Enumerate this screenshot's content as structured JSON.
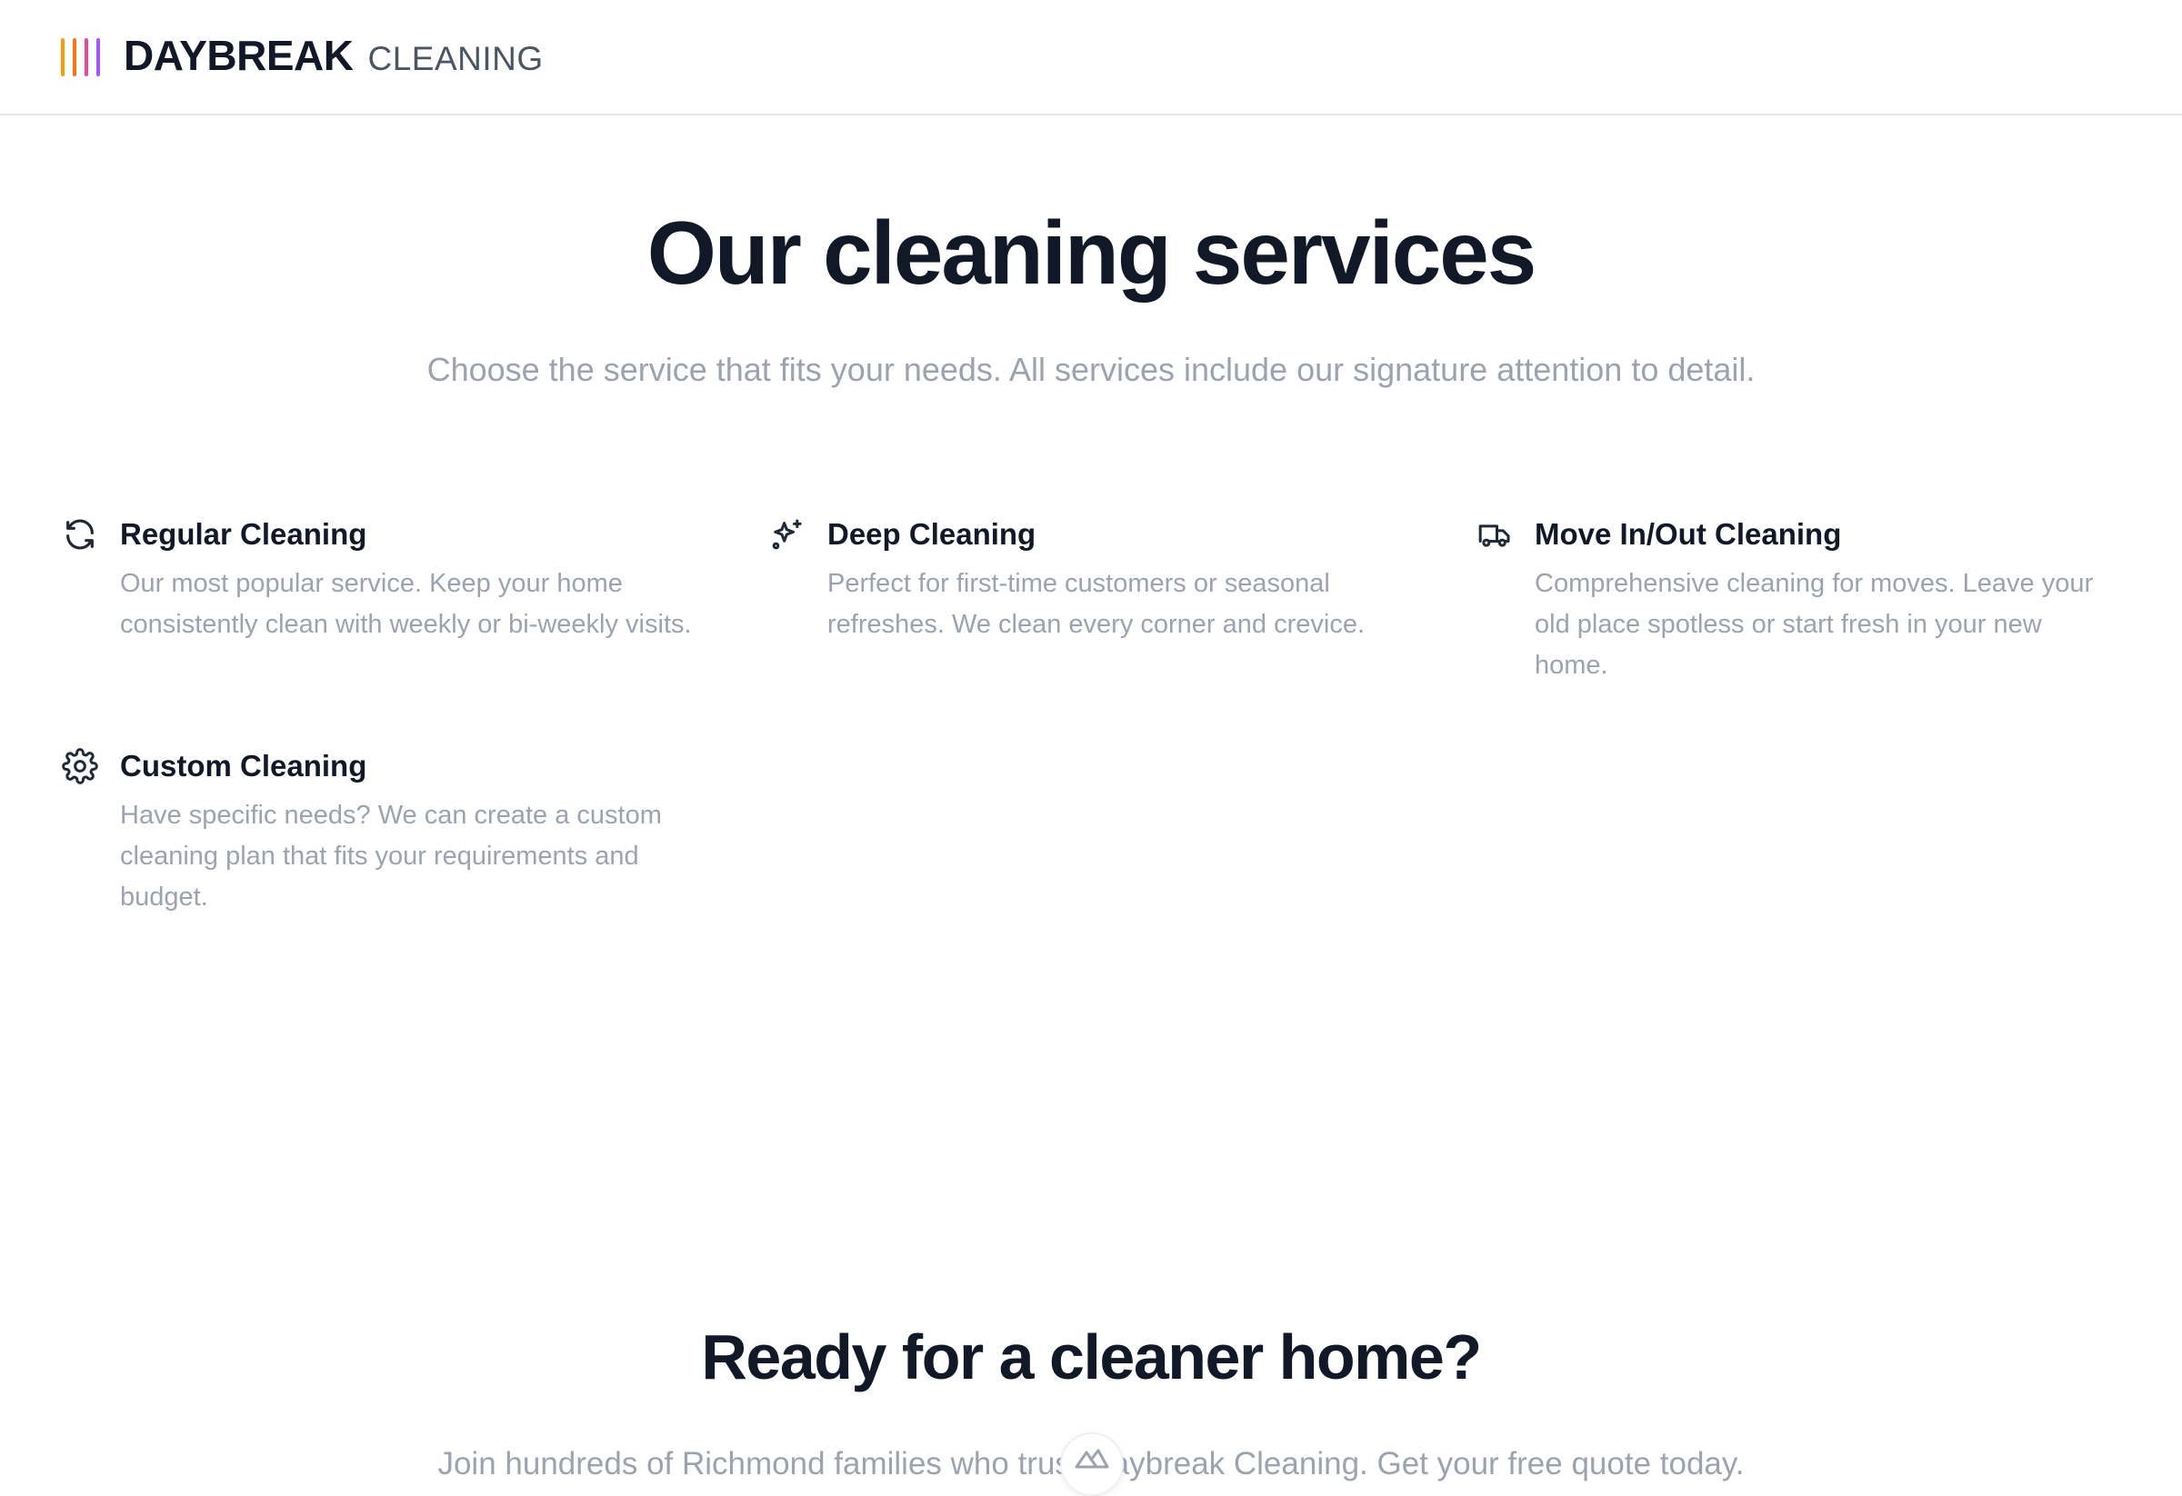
{
  "header": {
    "brand_name": "DAYBREAK",
    "brand_sub": "CLEANING",
    "logo_colors": [
      "#f59e0b",
      "#f97316",
      "#ec4899",
      "#a855f7"
    ]
  },
  "hero": {
    "title": "Our cleaning services",
    "subtitle": "Choose the service that fits your needs. All services include our signature attention to detail."
  },
  "services": [
    {
      "icon": "refresh-icon",
      "title": "Regular Cleaning",
      "description": "Our most popular service. Keep your home consistently clean with weekly or bi-weekly visits."
    },
    {
      "icon": "sparkles-icon",
      "title": "Deep Cleaning",
      "description": "Perfect for first-time customers or seasonal refreshes. We clean every corner and crevice."
    },
    {
      "icon": "truck-icon",
      "title": "Move In/Out Cleaning",
      "description": "Comprehensive cleaning for moves. Leave your old place spotless or start fresh in your new home."
    },
    {
      "icon": "gear-icon",
      "title": "Custom Cleaning",
      "description": "Have specific needs? We can create a custom cleaning plan that fits your requirements and budget."
    }
  ],
  "cta": {
    "title": "Ready for a cleaner home?",
    "subtitle": "Join hundreds of Richmond families who trust Daybreak Cleaning. Get your free quote today."
  },
  "colors": {
    "heading": "#111827",
    "muted": "#9ca3af",
    "border": "#e5e7eb"
  }
}
